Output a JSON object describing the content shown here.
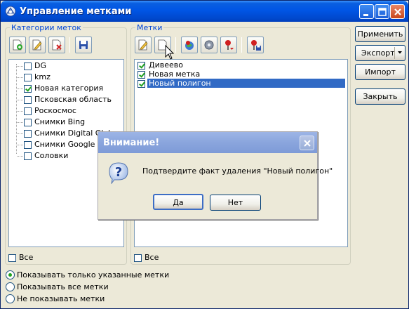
{
  "window": {
    "title": "Управление метками"
  },
  "categories_group": {
    "title": "Категории меток",
    "items": [
      {
        "label": "DG",
        "checked": false
      },
      {
        "label": "kmz",
        "checked": false
      },
      {
        "label": "Новая категория",
        "checked": true
      },
      {
        "label": "Псковская область",
        "checked": false
      },
      {
        "label": "Роскосмос",
        "checked": false
      },
      {
        "label": "Снимки Bing",
        "checked": false
      },
      {
        "label": "Снимки Digital Glob",
        "checked": false
      },
      {
        "label": "Снимки Google",
        "checked": false
      },
      {
        "label": "Соловки",
        "checked": false
      }
    ],
    "all_label": "Все"
  },
  "marks_group": {
    "title": "Метки",
    "items": [
      {
        "label": "Дивеево",
        "checked": true
      },
      {
        "label": "Новая метка",
        "checked": true
      },
      {
        "label": "Новый полигон",
        "checked": true,
        "selected": true
      }
    ],
    "all_label": "Все"
  },
  "side_buttons": {
    "apply": "Применить",
    "export": "Экспорт",
    "import": "Импорт",
    "close": "Закрыть"
  },
  "display_options": [
    {
      "label": "Показывать только указанные метки",
      "selected": true
    },
    {
      "label": "Показывать все метки",
      "selected": false
    },
    {
      "label": "Не показывать метки",
      "selected": false
    }
  ],
  "dialog": {
    "title": "Внимание!",
    "message": "Подтвердите факт удаления \"Новый полигон\"",
    "yes_label": "Да",
    "no_label": "Нет"
  },
  "colors": {
    "titlebar": "#0055e5",
    "selection": "#316ac5",
    "group_title": "#0046d5",
    "check_green": "#21a121"
  }
}
